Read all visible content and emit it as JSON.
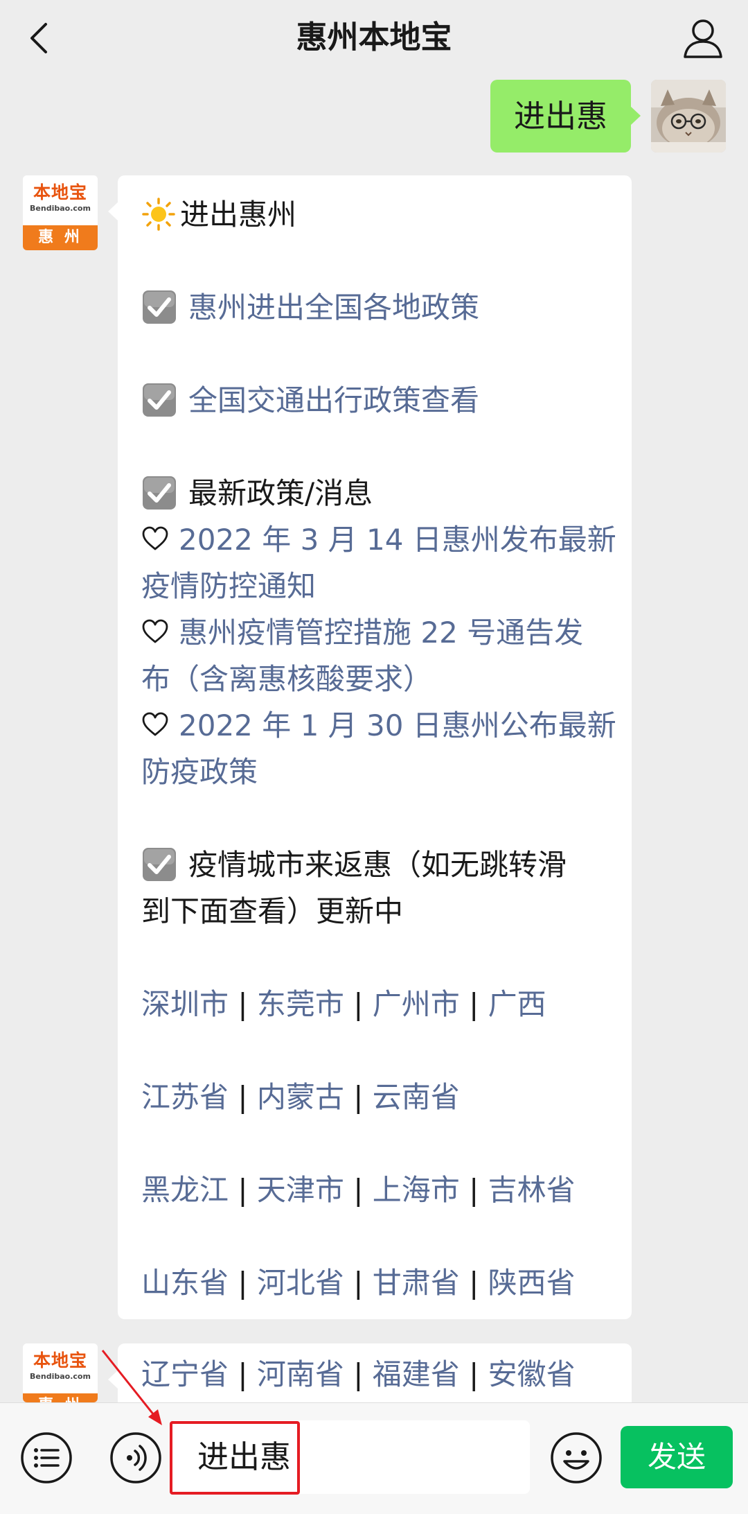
{
  "header": {
    "title": "惠州本地宝"
  },
  "user_message": {
    "text": "进出惠"
  },
  "bot_avatar": {
    "brand": "本地宝",
    "domain": "Bendibao.com",
    "city": "惠 州"
  },
  "reply": {
    "heading": "进出惠州",
    "link1": "惠州进出全国各地政策",
    "link2": "全国交通出行政策查看",
    "section_title": "最新政策/消息",
    "news": [
      {
        "line1": "2022 年 3 月 14 日惠州发布最新",
        "line2": "疫情防控通知"
      },
      {
        "line1": "惠州疫情管控措施 22 号通告发",
        "line2": "布（含离惠核酸要求）"
      },
      {
        "line1": "2022 年 1 月 30 日惠州公布最新",
        "line2": "防疫政策"
      }
    ],
    "cities_intro_line1": "疫情城市来返惠（如无跳转滑",
    "cities_intro_line2": "到下面查看）更新中",
    "city_rows": [
      [
        "深圳市",
        "东莞市",
        "广州市",
        "广西"
      ],
      [
        "江苏省",
        "内蒙古",
        "云南省"
      ],
      [
        "黑龙江",
        "天津市",
        "上海市",
        "吉林省"
      ],
      [
        "山东省",
        "河北省",
        "甘肃省",
        "陕西省"
      ]
    ],
    "separator": "|"
  },
  "second_reply": {
    "city_row": [
      "辽宁省",
      "河南省",
      "福建省",
      "安徽省"
    ]
  },
  "input_bar": {
    "input_value": "进出惠",
    "send_label": "发送"
  },
  "colors": {
    "background": "#ededed",
    "user_bubble": "#95ec69",
    "link": "#576b95",
    "send_button": "#07c160",
    "annotation": "#e51c23",
    "brand_orange": "#f07b1c"
  }
}
